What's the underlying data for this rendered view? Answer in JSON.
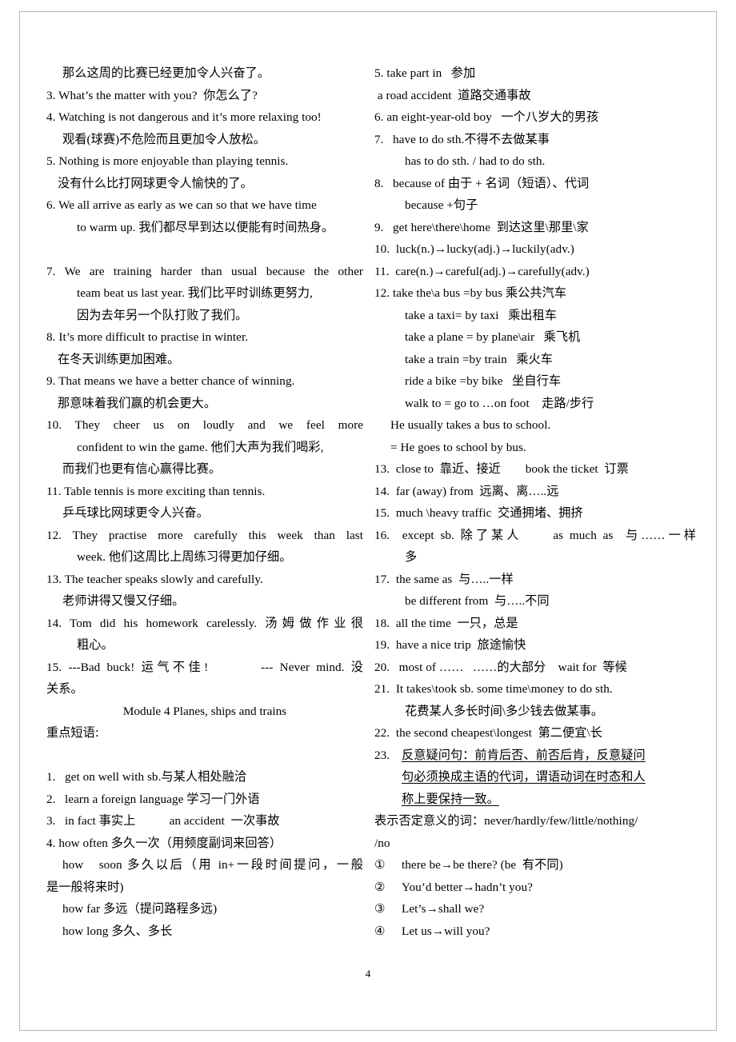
{
  "document": {
    "page_number": "4",
    "module_heading": "Module 4 Planes, ships and trains",
    "section_heading": "重点短语:"
  },
  "left_column": {
    "lines": [
      {
        "id": "l01",
        "text": "那么这周的比赛已经更加令人兴奋了。",
        "indent": "idt1"
      },
      {
        "id": "l02",
        "text": "3. What’s the matter with you?  你怎么了?",
        "indent": ""
      },
      {
        "id": "l03",
        "text": "4. Watching is not dangerous and it’s more relaxing too!",
        "indent": ""
      },
      {
        "id": "l04",
        "text": "观看(球赛)不危险而且更加令人放松。",
        "indent": "idt1"
      },
      {
        "id": "l05",
        "text": "5. Nothing is more enjoyable than playing tennis.",
        "indent": ""
      },
      {
        "id": "l06",
        "text": "没有什么比打网球更令人愉快的了。",
        "indent": "idt3"
      },
      {
        "id": "l07",
        "text": "6. We all arrive as early as we can so that we have time",
        "indent": ""
      },
      {
        "id": "l08",
        "text": "to warm up. 我们都尽早到达以便能有时间热身。",
        "indent": "idt2"
      },
      {
        "id": "l09",
        "text": "",
        "indent": "gap"
      },
      {
        "id": "l10",
        "text": "7. We are training harder than usual because the other",
        "indent": "",
        "justify": true
      },
      {
        "id": "l11",
        "text": "team beat us last year. 我们比平时训练更努力,",
        "indent": "idt2"
      },
      {
        "id": "l12",
        "text": "因为去年另一个队打败了我们。",
        "indent": "idt2"
      },
      {
        "id": "l13",
        "text": "8. It’s more difficult to practise in winter.",
        "indent": ""
      },
      {
        "id": "l14",
        "text": "在冬天训练更加困难。",
        "indent": "idt3"
      },
      {
        "id": "l15",
        "text": "9. That means we have a better chance of winning.",
        "indent": ""
      },
      {
        "id": "l16",
        "text": "那意味着我们赢的机会更大。",
        "indent": "idt3"
      },
      {
        "id": "l17",
        "text": "10.  They  cheer  us  on  loudly  and  we  feel  more",
        "indent": "",
        "justify": true
      },
      {
        "id": "l18",
        "text": "confident to win the game. 他们大声为我们喝彩,",
        "indent": "idt2"
      },
      {
        "id": "l19",
        "text": "而我们也更有信心赢得比赛。",
        "indent": "idt1"
      },
      {
        "id": "l20",
        "text": "11. Table tennis is more exciting than tennis.",
        "indent": ""
      },
      {
        "id": "l21",
        "text": "乒乓球比网球更令人兴奋。",
        "indent": "idt1"
      },
      {
        "id": "l22",
        "text": "12.  They  practise  more  carefully  this  week  than  last",
        "indent": "",
        "justify": true
      },
      {
        "id": "l23",
        "text": "week. 他们这周比上周练习得更加仔细。",
        "indent": "idt2"
      },
      {
        "id": "l24",
        "text": "13. The teacher speaks slowly and carefully.",
        "indent": ""
      },
      {
        "id": "l25",
        "text": "老师讲得又慢又仔细。",
        "indent": "idt1"
      },
      {
        "id": "l26",
        "text": "14. Tom did his homework carelessly. 汤姆做作业很",
        "indent": "",
        "justify": true
      },
      {
        "id": "l27",
        "text": "粗心。",
        "indent": "idt2"
      },
      {
        "id": "l28",
        "text": "15. ---Bad buck! 运气不佳!        --- Never mind. 没",
        "indent": "",
        "justify": true
      },
      {
        "id": "l29",
        "text": "关系。",
        "indent": ""
      }
    ],
    "phrases": [
      {
        "id": "p1",
        "text": "1.   get on well with sb.与某人相处融洽",
        "indent": ""
      },
      {
        "id": "p2",
        "text": "2.   learn a foreign language 学习一门外语",
        "indent": ""
      },
      {
        "id": "p3",
        "text": "3.   in fact 事实上           an accident  一次事故",
        "indent": ""
      },
      {
        "id": "p4",
        "text": "4. how often 多久一次（用频度副词来回答）",
        "indent": ""
      },
      {
        "id": "p5",
        "text": "how   soon 多久以后（用 in+一段时间提问，一般",
        "indent": "idt1",
        "justify": true
      },
      {
        "id": "p6",
        "text": "是一般将来时)",
        "indent": ""
      },
      {
        "id": "p7",
        "text": "how far 多远（提问路程多远)",
        "indent": "idt1"
      },
      {
        "id": "p8",
        "text": "how long 多久、多长",
        "indent": "idt1"
      }
    ]
  },
  "right_column": {
    "lines": [
      {
        "id": "r01",
        "text": "5. take part in   参加",
        "indent": ""
      },
      {
        "id": "r02",
        "text": " a road accident  道路交通事故",
        "indent": ""
      },
      {
        "id": "r03",
        "text": "6. an eight-year-old boy   一个八岁大的男孩",
        "indent": ""
      },
      {
        "id": "r04",
        "text": "7.   have to do sth.不得不去做某事",
        "indent": ""
      },
      {
        "id": "r05",
        "text": "has to do sth. / had to do sth.",
        "indent": "idt2"
      },
      {
        "id": "r06",
        "text": "8.   because of 由于 + 名词（短语）、代词",
        "indent": ""
      },
      {
        "id": "r07",
        "text": "because +句子",
        "indent": "idt2"
      },
      {
        "id": "r08",
        "text": "9.   get here\\there\\home  到达这里\\那里\\家",
        "indent": ""
      },
      {
        "id": "r09",
        "text": "10.  luck(n.)→lucky(adj.)→luckily(adv.)",
        "indent": ""
      },
      {
        "id": "r10",
        "text": "11.  care(n.)→careful(adj.)→carefully(adv.)",
        "indent": ""
      },
      {
        "id": "r11",
        "text": "12. take the\\a bus =by bus 乘公共汽车",
        "indent": ""
      },
      {
        "id": "r12",
        "text": "take a taxi= by taxi   乘出租车",
        "indent": "idt2"
      },
      {
        "id": "r13",
        "text": "take a plane = by plane\\air   乘飞机",
        "indent": "idt2"
      },
      {
        "id": "r14",
        "text": "take a train =by train   乘火车",
        "indent": "idt2"
      },
      {
        "id": "r15",
        "text": "ride a bike =by bike   坐自行车",
        "indent": "idt2"
      },
      {
        "id": "r16",
        "text": "walk to = go to …on foot    走路/步行",
        "indent": "idt2"
      },
      {
        "id": "r17",
        "text": "He usually takes a bus to school.",
        "indent": "idt1"
      },
      {
        "id": "r18",
        "text": "= He goes to school by bus.",
        "indent": "idt1"
      },
      {
        "id": "r19",
        "text": "13.  close to  靠近、接近        book the ticket  订票",
        "indent": ""
      },
      {
        "id": "r20",
        "text": "14.  far (away) from  远离、离…..远",
        "indent": ""
      },
      {
        "id": "r21",
        "text": "15.  much \\heavy traffic  交通拥堵、拥挤",
        "indent": ""
      },
      {
        "id": "r22",
        "text": "16.  except sb. 除了某人     as much as  与……一样",
        "indent": "",
        "justify": true
      },
      {
        "id": "r23",
        "text": "多",
        "indent": "idt2"
      },
      {
        "id": "r24",
        "text": "17.  the same as  与…..一样",
        "indent": ""
      },
      {
        "id": "r25",
        "text": "be different from  与…..不同",
        "indent": "idt2"
      },
      {
        "id": "r26",
        "text": "18.  all the time  一只，总是",
        "indent": ""
      },
      {
        "id": "r27",
        "text": "19.  have a nice trip  旅途愉快",
        "indent": ""
      },
      {
        "id": "r28",
        "text": "20.   most of ……   ……的大部分    wait for  等候",
        "indent": ""
      },
      {
        "id": "r29",
        "text": "21.  It takes\\took sb. some time\\money to do sth.",
        "indent": ""
      },
      {
        "id": "r30",
        "text": "花费某人多长时间\\多少钱去做某事。",
        "indent": "idt2"
      },
      {
        "id": "r31",
        "text": "22.  the second cheapest\\longest  第二便宜\\长",
        "indent": ""
      }
    ],
    "item23": {
      "number": "23.",
      "underlined_lines": [
        "反意疑问句：前肯后否、前否后肯，反意疑问",
        "句必须换成主语的代词，谓语动词在时态和人",
        "称上要保持一致。"
      ]
    },
    "negatives": {
      "line1": "表示否定意义的词：never/hardly/few/little/nothing/",
      "line2": "/no"
    },
    "circled_items": [
      {
        "marker": "①",
        "text": "there be→be there? (be  有不同)"
      },
      {
        "marker": "②",
        "text": "You’d better→hadn’t you?"
      },
      {
        "marker": "③",
        "text": "Let’s→shall we?"
      },
      {
        "marker": "④",
        "text": "Let us→will you?"
      }
    ]
  }
}
